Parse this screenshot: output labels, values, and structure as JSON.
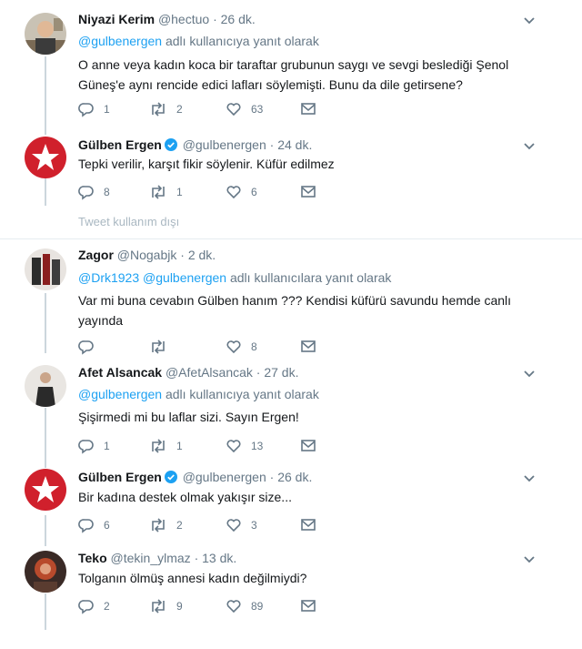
{
  "tweets": [
    {
      "name": "Niyazi Kerim",
      "handle": "@hectuo",
      "time": "26 dk.",
      "reply_mentions": [
        "@gulbenergen"
      ],
      "reply_suffix": "adlı kullanıcıya yanıt olarak",
      "text": "O anne veya kadın koca bir taraftar grubunun saygı ve sevgi beslediği Şenol Güneş'e aynı rencide edici lafları söylemişti. Bunu da dile getirsene?",
      "replies": "1",
      "retweets": "2",
      "likes": "63",
      "verified": false
    },
    {
      "name": "Gülben Ergen",
      "handle": "@gulbenergen",
      "time": "24 dk.",
      "text": "Tepki verilir, karşıt fikir söylenir. Küfür edilmez",
      "replies": "8",
      "retweets": "1",
      "likes": "6",
      "verified": true
    },
    {
      "name": "Zagor",
      "handle": "@Nogabjk",
      "time": "2 dk.",
      "reply_mentions": [
        "@Drk1923",
        "@gulbenergen"
      ],
      "reply_suffix": "adlı kullanıcılara yanıt olarak",
      "text": "Var mi buna cevabın Gülben hanım ??? Kendisi küfürü savundu hemde canlı yayında",
      "replies": "",
      "retweets": "",
      "likes": "8",
      "verified": false
    },
    {
      "name": "Afet Alsancak",
      "handle": "@AfetAlsancak",
      "time": "27 dk.",
      "reply_mentions": [
        "@gulbenergen"
      ],
      "reply_suffix": "adlı kullanıcıya yanıt olarak",
      "text": "Şişirmedi mi bu laflar sizi. Sayın Ergen!",
      "replies": "1",
      "retweets": "1",
      "likes": "13",
      "verified": false
    },
    {
      "name": "Gülben Ergen",
      "handle": "@gulbenergen",
      "time": "26 dk.",
      "text": "Bir kadına destek olmak yakışır size...",
      "replies": "6",
      "retweets": "2",
      "likes": "3",
      "verified": true
    },
    {
      "name": "Teko",
      "handle": "@tekin_ylmaz",
      "time": "13 dk.",
      "text": "Tolganın ölmüş annesi kadın değilmiydi?",
      "replies": "2",
      "retweets": "9",
      "likes": "89",
      "verified": false
    }
  ],
  "unavailable_label": "Tweet kullanım dışı",
  "colors": {
    "link": "#1da1f2",
    "muted": "#657786",
    "line": "#ccd6dd"
  }
}
